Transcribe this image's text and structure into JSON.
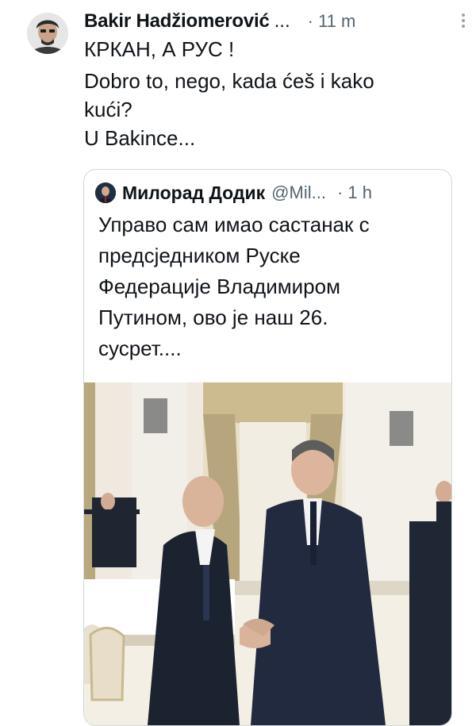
{
  "tweet": {
    "author_name": "Bakir Hadžiomerović",
    "name_ellipsis": "...",
    "time": "· 11 m",
    "lines": [
      "КРКАН, А РУС !",
      "Dobro to, nego, kada ćeš i kako",
      "kući?",
      "U Bakince..."
    ]
  },
  "quote": {
    "author_name": "Милорад Додик",
    "handle": "@Mil...",
    "time": "· 1 h",
    "lines": [
      "Управо сам имао састанак с",
      "предсједником Руске",
      "Федерације Владимиром",
      "Путином, ово је наш 26.",
      "сусрет...."
    ]
  },
  "icons": {
    "more": "more-vertical-icon"
  },
  "colors": {
    "text": "#0f1419",
    "secondary": "#536471",
    "border": "#cfd9de"
  }
}
